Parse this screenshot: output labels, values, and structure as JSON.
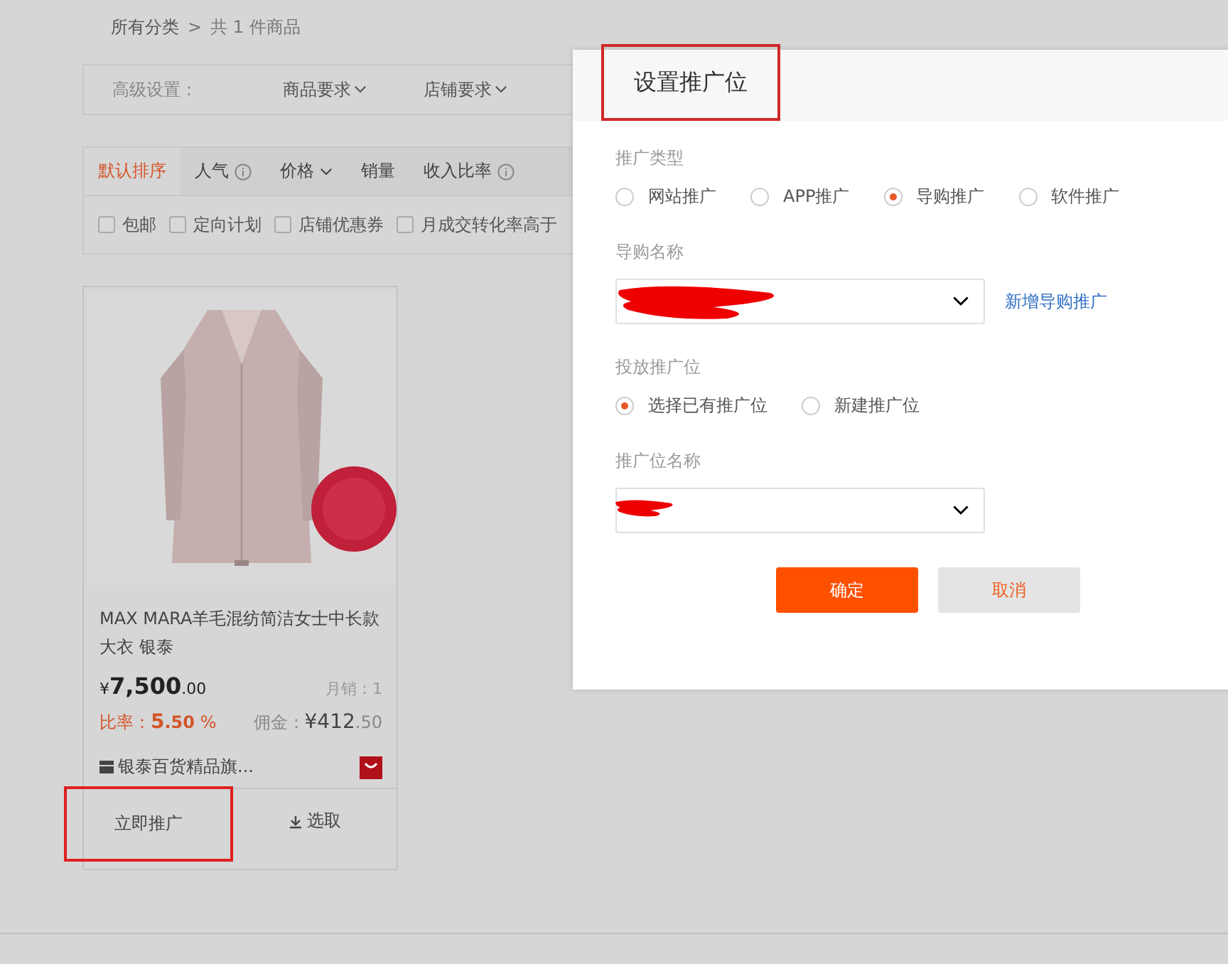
{
  "breadcrumb": {
    "root": "所有分类",
    "separator": ">",
    "count": "共 1 件商品"
  },
  "filter_bar": {
    "label": "高级设置：",
    "dropdowns": [
      "商品要求",
      "店铺要求"
    ]
  },
  "sort_tabs": [
    {
      "label": "默认排序",
      "selected": true,
      "kind": "plain"
    },
    {
      "label": "人气",
      "selected": false,
      "kind": "info"
    },
    {
      "label": "价格",
      "selected": false,
      "kind": "dropdown"
    },
    {
      "label": "销量",
      "selected": false,
      "kind": "plain"
    },
    {
      "label": "收入比率",
      "selected": false,
      "kind": "info"
    }
  ],
  "filters": [
    {
      "label": "包邮",
      "checked": false
    },
    {
      "label": "定向计划",
      "checked": false
    },
    {
      "label": "店铺优惠券",
      "checked": false
    },
    {
      "label": "月成交转化率高于",
      "checked": false
    }
  ],
  "product": {
    "title": "MAX MARA羊毛混纺简洁女士中长款大衣 银泰",
    "price_symbol": "¥",
    "price_int": "7,500",
    "price_dec": ".00",
    "sales": "月销：1",
    "rate_label": "比率：",
    "rate_int": "5",
    "rate_dec": ".50",
    "rate_unit": "%",
    "commission_label": "佣金：",
    "commission_symbol": "¥",
    "commission_int": "412",
    "commission_dec": ".50",
    "shop": "银泰百货精品旗...",
    "actions": [
      {
        "label": "立即推广",
        "kind": "plain",
        "highlighted": true
      },
      {
        "label": "选取",
        "kind": "download",
        "highlighted": false
      }
    ]
  },
  "modal": {
    "title": "设置推广位",
    "title_highlighted": true,
    "sections": [
      {
        "kind": "radio",
        "label": "推广类型",
        "options": [
          {
            "label": "网站推广",
            "selected": false
          },
          {
            "label": "APP推广",
            "selected": false
          },
          {
            "label": "导购推广",
            "selected": true
          },
          {
            "label": "软件推广",
            "selected": false
          }
        ]
      },
      {
        "kind": "select",
        "label": "导购名称",
        "redacted": true,
        "link": "新增导购推广"
      },
      {
        "kind": "radio",
        "label": "投放推广位",
        "options": [
          {
            "label": "选择已有推广位",
            "selected": true
          },
          {
            "label": "新建推广位",
            "selected": false
          }
        ]
      },
      {
        "kind": "select",
        "label": "推广位名称",
        "redacted": true
      }
    ],
    "buttons": [
      {
        "label": "确定",
        "kind": "primary"
      },
      {
        "label": "取消",
        "kind": "secondary"
      }
    ]
  }
}
